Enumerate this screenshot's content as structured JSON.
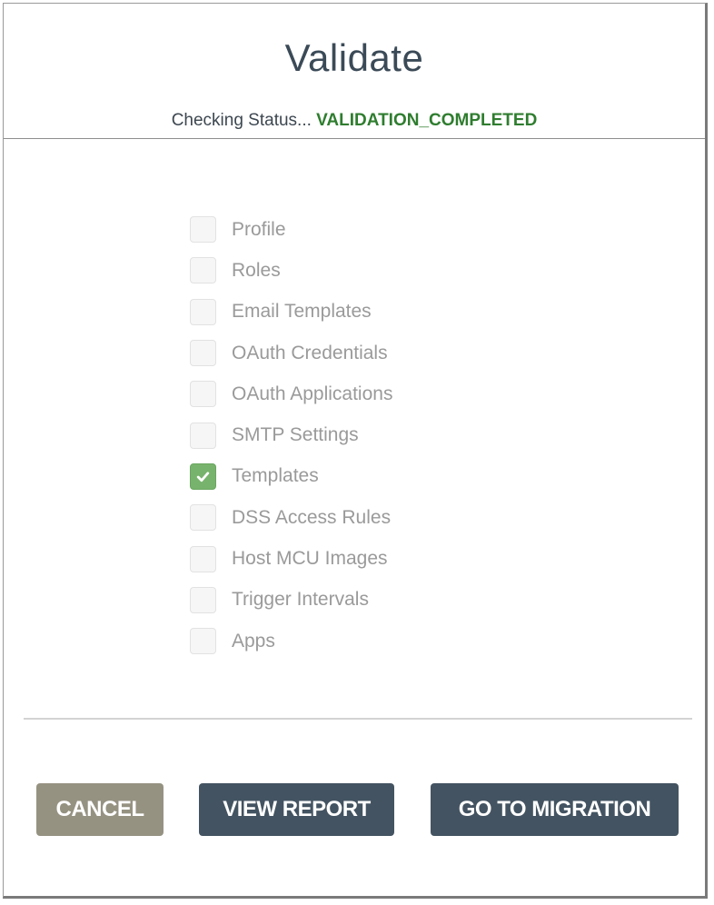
{
  "dialog": {
    "title": "Validate",
    "status_prefix": "Checking Status...",
    "status_value": "VALIDATION_COMPLETED"
  },
  "items": [
    {
      "label": "Profile",
      "checked": false
    },
    {
      "label": "Roles",
      "checked": false
    },
    {
      "label": "Email Templates",
      "checked": false
    },
    {
      "label": "OAuth Credentials",
      "checked": false
    },
    {
      "label": "OAuth Applications",
      "checked": false
    },
    {
      "label": "SMTP Settings",
      "checked": false
    },
    {
      "label": "Templates",
      "checked": true
    },
    {
      "label": "DSS Access Rules",
      "checked": false
    },
    {
      "label": "Host MCU Images",
      "checked": false
    },
    {
      "label": "Trigger Intervals",
      "checked": false
    },
    {
      "label": "Apps",
      "checked": false
    }
  ],
  "buttons": {
    "cancel": "CANCEL",
    "view_report": "VIEW REPORT",
    "go_to_migration": "GO TO MIGRATION"
  },
  "colors": {
    "status_success": "#2f7d2f",
    "checked_box": "#78b36d",
    "primary_button": "#435361",
    "cancel_button": "#969282"
  },
  "icons": {
    "checked": "checkmark-icon"
  }
}
